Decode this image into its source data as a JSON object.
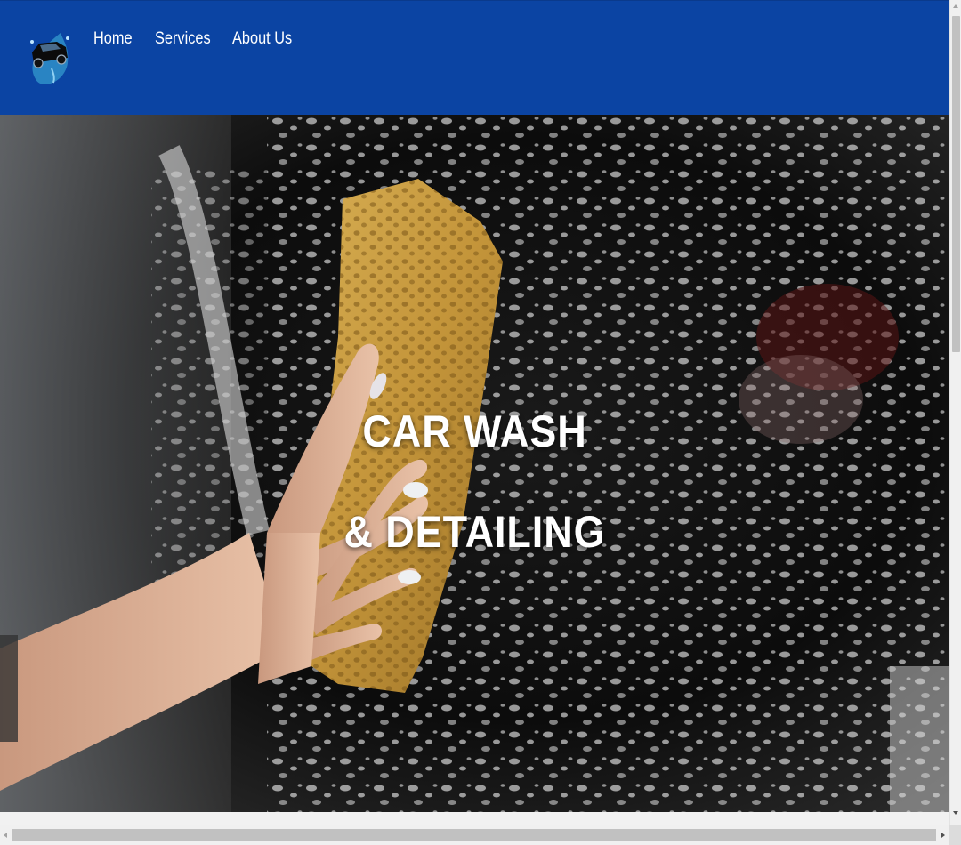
{
  "navbar": {
    "logo_icon": "car-wash-logo-icon",
    "links": [
      {
        "label": "Home"
      },
      {
        "label": "Services"
      },
      {
        "label": "About Us"
      }
    ]
  },
  "hero": {
    "line1": "CAR WASH",
    "line2": "& DETAILING",
    "image_subject": "hand washing a black car with a yellow sponge and foam"
  },
  "colors": {
    "navbar_bg": "#0b44a3",
    "hero_text": "#ffffff",
    "sponge": "#c39a3e"
  }
}
